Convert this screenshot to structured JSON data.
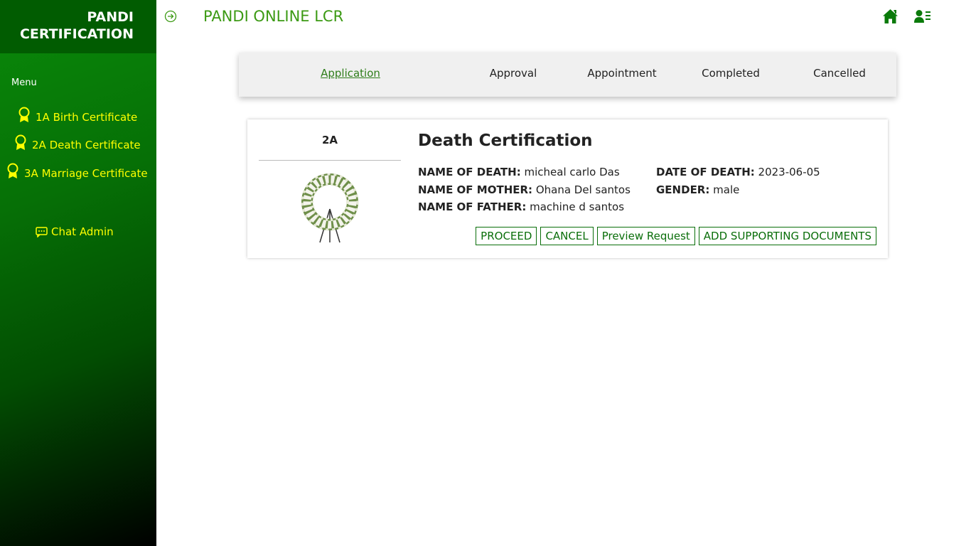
{
  "sidebar": {
    "brand_line1": "PANDI",
    "brand_line2": "CERTIFICATION",
    "menu_title": "Menu",
    "items": [
      {
        "label": "1A Birth Certificate",
        "icon": "award-icon"
      },
      {
        "label": "2A Death Certificate",
        "icon": "award-icon"
      },
      {
        "label": "3A Marriage Certificate",
        "icon": "award-icon"
      }
    ],
    "chat_admin": "Chat Admin"
  },
  "header": {
    "title": "PANDI ONLINE LCR",
    "toggle_icon": "arrow-right-circle-icon",
    "home_icon": "home-icon",
    "profile_icon": "user-list-icon"
  },
  "tabs": {
    "items": [
      "Application",
      "Approval",
      "Appointment",
      "Completed",
      "Cancelled"
    ],
    "active": "Application"
  },
  "card": {
    "code": "2A",
    "title": "Death Certification",
    "image": "funeral-wreath-image",
    "fields": {
      "name_of_death_label": "NAME OF DEATH:",
      "name_of_death": "micheal carlo Das",
      "date_of_death_label": "DATE OF DEATH:",
      "date_of_death": "2023-06-05",
      "name_of_mother_label": "NAME OF MOTHER:",
      "name_of_mother": "Ohana Del santos",
      "gender_label": "GENDER:",
      "gender": "male",
      "name_of_father_label": "NAME OF FATHER:",
      "name_of_father": "machine d santos"
    },
    "buttons": {
      "proceed": "PROCEED",
      "cancel": "CANCEL",
      "preview": "Preview Request",
      "add_docs": "ADD SUPPORTING DOCUMENTS"
    }
  },
  "colors": {
    "sidebar_top": "#0a8a0a",
    "sidebar_bottom": "#000000",
    "brand_bg": "#015c01",
    "nav_text": "#ffff00",
    "title_green": "#3c9a14",
    "button_green": "#0a6e0a"
  }
}
